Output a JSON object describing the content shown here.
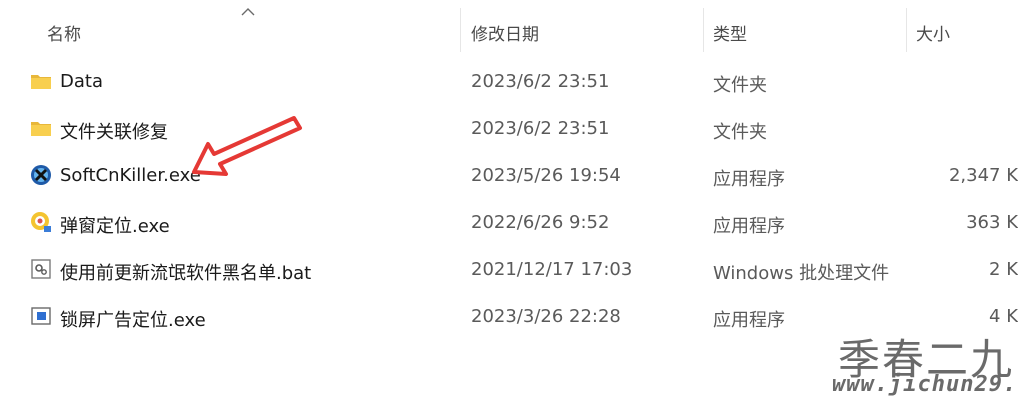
{
  "columns": {
    "name": "名称",
    "modified": "修改日期",
    "type": "类型",
    "size": "大小"
  },
  "files": [
    {
      "icon": "folder-icon",
      "name": "Data",
      "modified": "2023/6/2 23:51",
      "type": "文件夹",
      "size": ""
    },
    {
      "icon": "folder-icon",
      "name": "文件关联修复",
      "modified": "2023/6/2 23:51",
      "type": "文件夹",
      "size": ""
    },
    {
      "icon": "softcnkiller-app-icon",
      "name": "SoftCnKiller.exe",
      "modified": "2023/5/26 19:54",
      "type": "应用程序",
      "size": "2,347 K"
    },
    {
      "icon": "target-app-icon",
      "name": "弹窗定位.exe",
      "modified": "2022/6/26 9:52",
      "type": "应用程序",
      "size": "363 K"
    },
    {
      "icon": "batch-file-icon",
      "name": "使用前更新流氓软件黑名单.bat",
      "modified": "2021/12/17 17:03",
      "type": "Windows 批处理文件",
      "size": "2 K"
    },
    {
      "icon": "window-app-icon",
      "name": "锁屏广告定位.exe",
      "modified": "2023/3/26 22:28",
      "type": "应用程序",
      "size": "4 K"
    }
  ],
  "watermark": {
    "name": "季春二九",
    "url": "www.jichun29.cn"
  },
  "colors": {
    "folder": "#f5c542",
    "arrow": "#e53935"
  }
}
